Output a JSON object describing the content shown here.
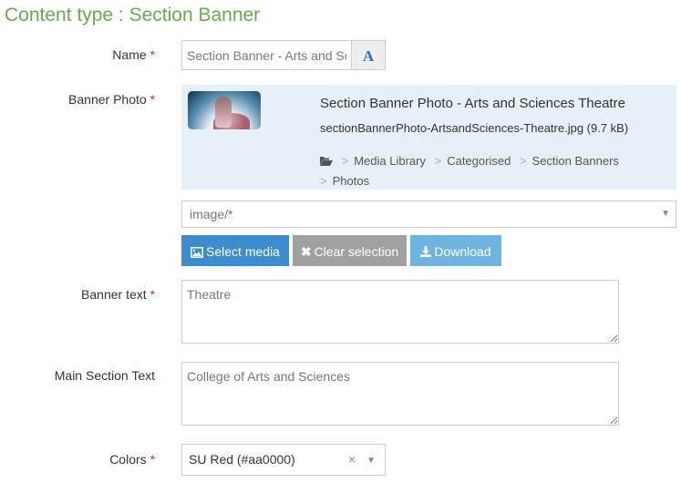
{
  "page": {
    "title": "Content type : Section Banner"
  },
  "fields": {
    "name": {
      "label": "Name",
      "required_mark": "*",
      "value": "Section Banner - Arts and Sciences Theatre",
      "translate_addon": "A"
    },
    "banner_photo": {
      "label": "Banner Photo",
      "required_mark": "*",
      "media": {
        "title": "Section Banner Photo - Arts and Sciences Theatre",
        "filename": "sectionBannerPhoto-ArtsandSciences-Theatre.jpg (9.7 kB)",
        "path": [
          "Media Library",
          "Categorised",
          "Section Banners",
          "Photos"
        ],
        "path_separator": ">"
      },
      "type_filter": "image/*",
      "buttons": {
        "select": "Select media",
        "clear": "Clear selection",
        "download": "Download"
      }
    },
    "banner_text": {
      "label": "Banner text",
      "required_mark": "*",
      "value": "Theatre"
    },
    "main_section_text": {
      "label": "Main Section Text",
      "value": "College of Arts and Sciences"
    },
    "colors": {
      "label": "Colors",
      "required_mark": "*",
      "value": "SU Red (#aa0000)",
      "clear_glyph": "×"
    }
  },
  "colors": {
    "title_green": "#6aa84f",
    "primary_blue": "#3d8ccd",
    "required_red": "#c9302c",
    "panel_bg": "#e5f0f7"
  }
}
